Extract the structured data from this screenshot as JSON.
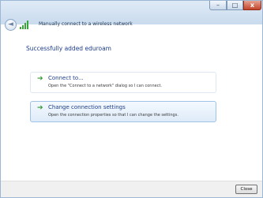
{
  "window": {
    "minimize_glyph": "–",
    "maximize_glyph": "□",
    "close_glyph": "x"
  },
  "header": {
    "back_glyph": "◄",
    "title": "Manually connect to a wireless network"
  },
  "main": {
    "title": "Successfully added eduroam",
    "options": [
      {
        "label": "Connect to...",
        "description": "Open the \"Connect to a network\" dialog so I can connect."
      },
      {
        "label": "Change connection settings",
        "description": "Open the connection properties so that I can change the settings."
      }
    ]
  },
  "footer": {
    "close_label": "Close"
  },
  "icons": {
    "arrow": "➔",
    "arrow_color": "#2f9b2f",
    "signal_color": "#3aa53a"
  }
}
